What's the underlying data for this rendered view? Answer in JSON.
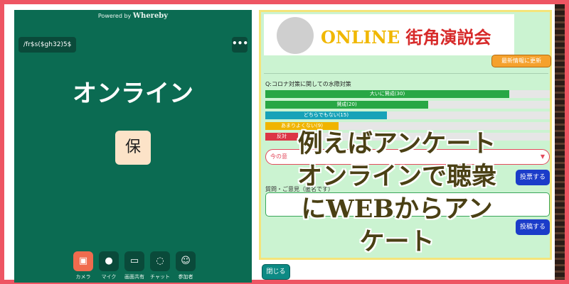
{
  "whereby": {
    "powered_prefix": "Powered by",
    "powered_brand": "Whereby",
    "room_name": "/fr$s($gh32)5$",
    "menu_glyph": "•••",
    "room_title": "オンライン",
    "avatar_initial": "保",
    "controls": [
      {
        "icon": "camera-off-icon",
        "glyph": "▣",
        "label": "カメラ",
        "active": false
      },
      {
        "icon": "microphone-icon",
        "glyph": "●",
        "label": "マイク",
        "active": true
      },
      {
        "icon": "screen-share-icon",
        "glyph": "▭",
        "label": "画面共有",
        "active": true
      },
      {
        "icon": "chat-icon",
        "glyph": "◌",
        "label": "チャット",
        "active": true
      },
      {
        "icon": "participants-icon",
        "glyph": "☺",
        "label": "参加者",
        "active": true
      }
    ]
  },
  "poll_panel": {
    "banner_online": "ONLINE",
    "banner_rest": " 街角演説会",
    "update_button": "最新情報に更新",
    "question": "Q:コロナ対策に関しての水際対策",
    "options": [
      {
        "label": "大いに賛成(30)",
        "count": 30,
        "color": "#28a745"
      },
      {
        "label": "賛成(20)",
        "count": 20,
        "color": "#28a745"
      },
      {
        "label": "どちらでもない(15)",
        "count": 15,
        "color": "#17a2b8"
      },
      {
        "label": "あまりよくない(9)",
        "count": 9,
        "color": "#f0b400"
      },
      {
        "label": "反対",
        "count": 4,
        "color": "#dc3545"
      }
    ],
    "bar_max": 35,
    "comment_placeholder": "今の意",
    "vote_button": "投票する",
    "question_label": "質問・ご意見（匿名です）",
    "post_button": "投稿する",
    "close_button": "閉じる"
  },
  "overlay": {
    "lines": [
      "例えばアンケート",
      "オンラインで聴衆",
      "にWEBからアン",
      "ケート"
    ]
  },
  "colors": {
    "frame": "#ee5563",
    "whereby_bg": "#0b6b52",
    "panel_bg": "#cbf3d1",
    "button_blue": "#1b3cc9",
    "update_orange": "#f5a12d"
  }
}
